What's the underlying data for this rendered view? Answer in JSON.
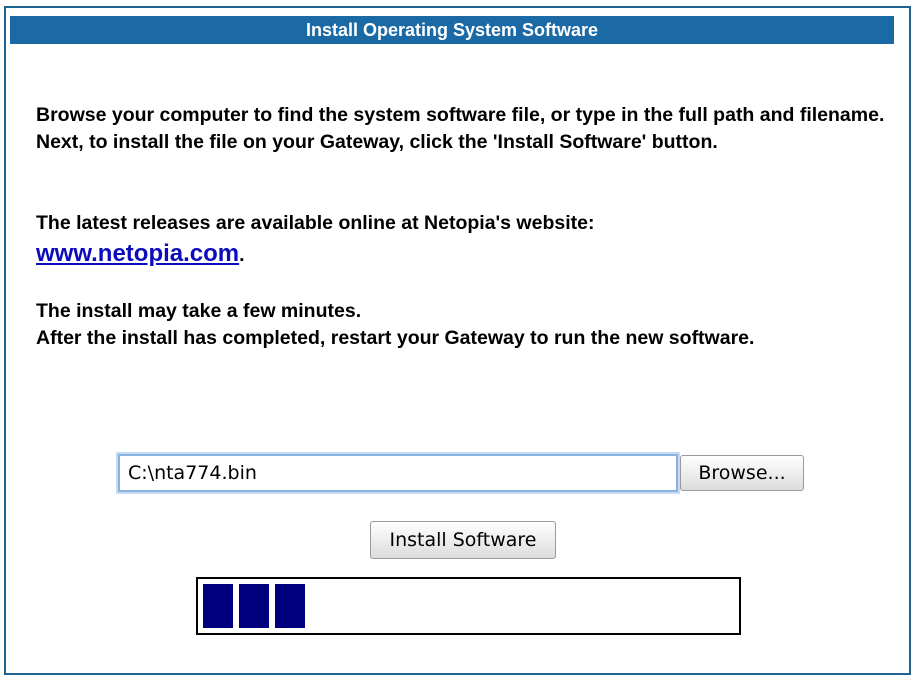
{
  "header": {
    "title": "Install Operating System Software"
  },
  "instructions": {
    "line1": "Browse your computer to find the system software file, or type in the full path and filename.",
    "line2": "Next, to install the file on your Gateway, click the 'Install Software' button.",
    "releases_text": "The latest releases are available online at Netopia's website:",
    "link_text": "www.netopia.com",
    "link_suffix": ".",
    "note1": "The install may take a few minutes.",
    "note2": "After the install has completed, restart your Gateway to run the new software."
  },
  "file_picker": {
    "value": "C:\\nta774.bin",
    "browse_label": "Browse..."
  },
  "install_button": {
    "label": "Install Software"
  },
  "progress": {
    "filled_blocks": 3,
    "block_color": "#00007f"
  },
  "colors": {
    "title_bar": "#1b6aa5",
    "link": "#0c0cbd"
  }
}
